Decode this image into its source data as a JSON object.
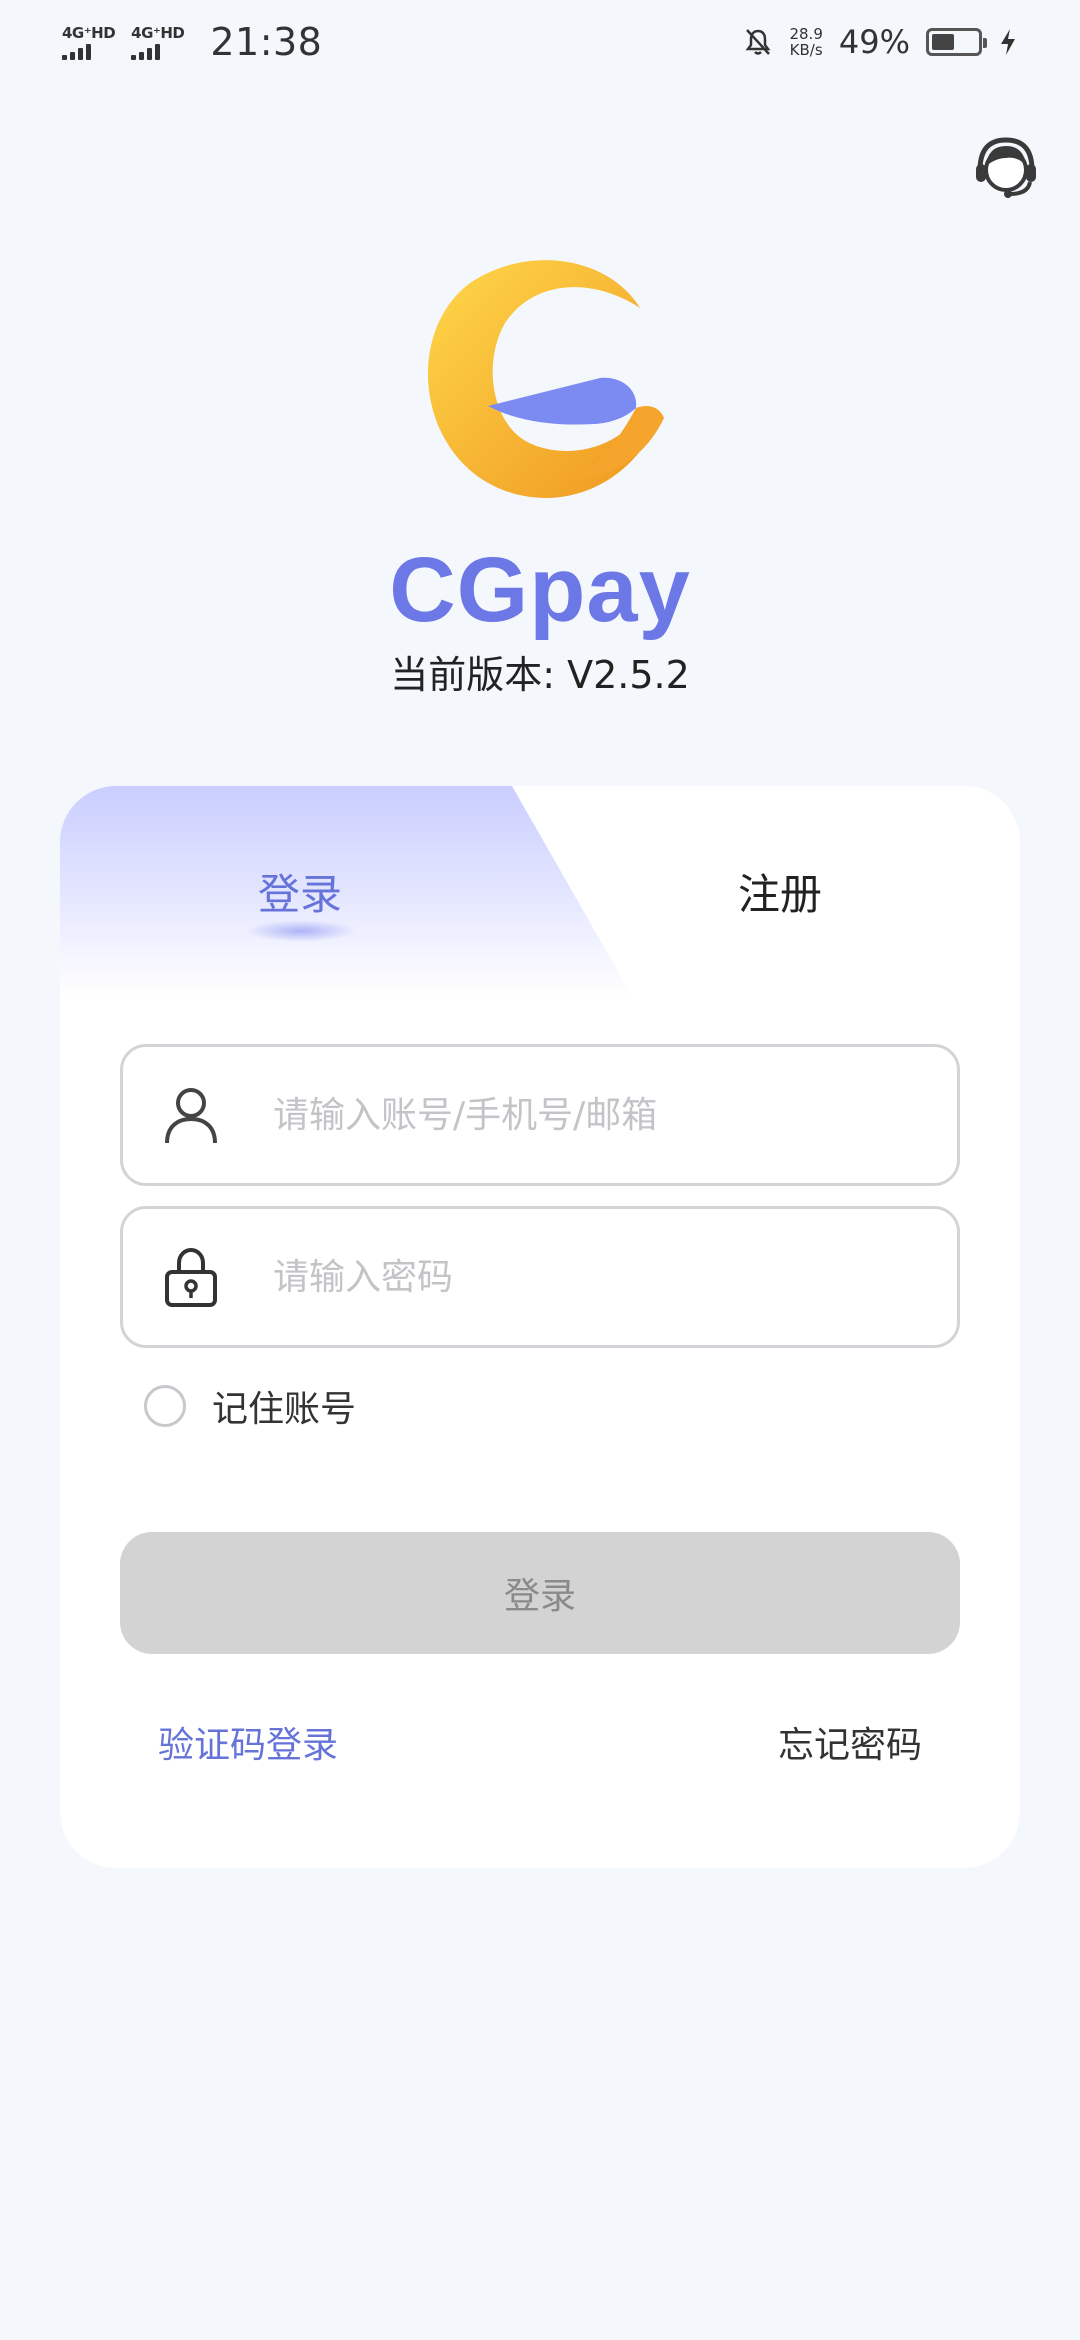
{
  "status_bar": {
    "network_1": "4G⁺HD",
    "network_2": "4G⁺HD",
    "time": "21:38",
    "speed_value": "28.9",
    "speed_unit": "KB/s",
    "battery_percent": "49%",
    "battery_level": 0.49
  },
  "app": {
    "name": "CGpay",
    "version": "当前版本: V2.5.2"
  },
  "tabs": {
    "login": "登录",
    "register": "注册"
  },
  "form": {
    "account_placeholder": "请输入账号/手机号/邮箱",
    "password_placeholder": "请输入密码",
    "remember_label": "记住账号",
    "submit_label": "登录",
    "sms_login": "验证码登录",
    "forgot_password": "忘记密码"
  },
  "icons": {
    "support": "customer-service-icon",
    "user": "user-icon",
    "lock": "lock-icon",
    "mute": "bell-off-icon",
    "charging": "charging-bolt-icon"
  },
  "colors": {
    "accent": "#6673d9",
    "brand": "#6b78e6",
    "logo_yellow": "#f6b73c",
    "logo_blue": "#7b8bf2",
    "button_disabled": "#d3d3d3",
    "background": "#f4f7fc"
  }
}
